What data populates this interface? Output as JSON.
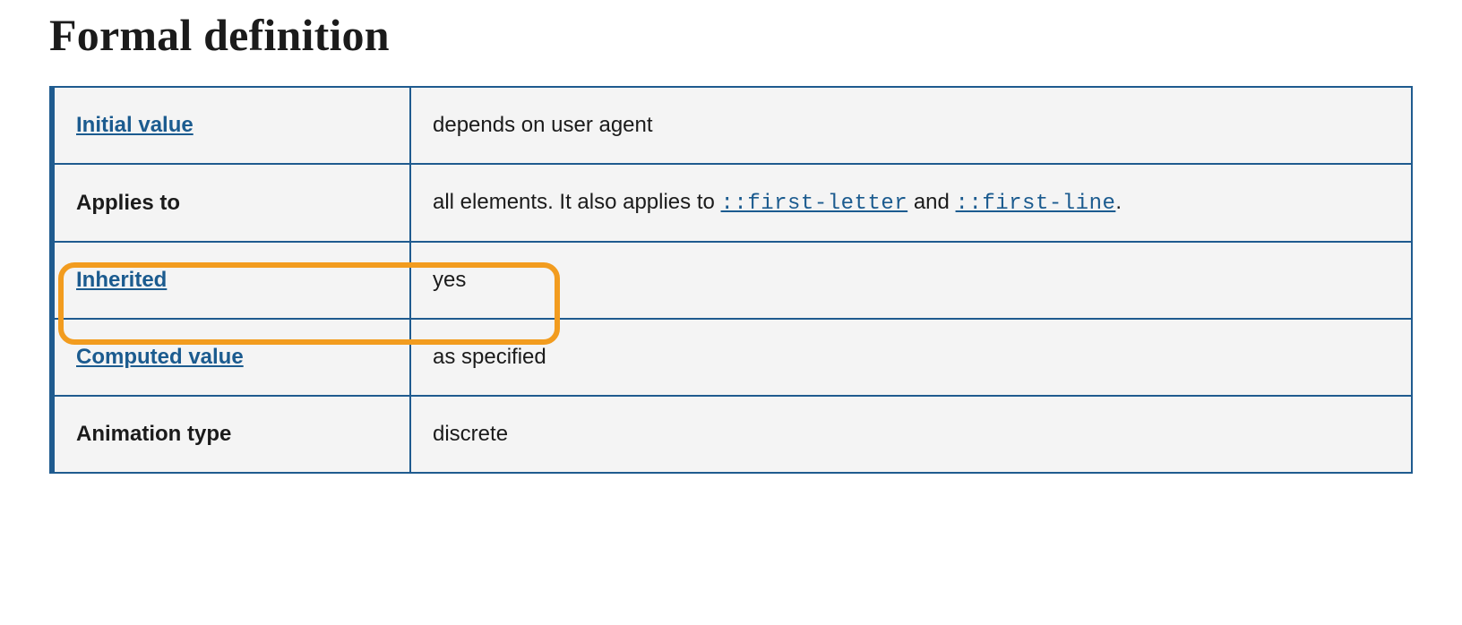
{
  "heading": "Formal definition",
  "rows": {
    "initial_value": {
      "label": "Initial value",
      "is_link": true,
      "value": "depends on user agent"
    },
    "applies_to": {
      "label": "Applies to",
      "value_prefix": "all elements. It also applies to ",
      "link1": "::first-letter",
      "connector": " and ",
      "link2": "::first-line",
      "suffix": "."
    },
    "inherited": {
      "label": "Inherited",
      "is_link": true,
      "value": "yes"
    },
    "computed_value": {
      "label": "Computed value",
      "is_link": true,
      "value": "as specified"
    },
    "animation_type": {
      "label": "Animation type",
      "value": "discrete"
    }
  }
}
